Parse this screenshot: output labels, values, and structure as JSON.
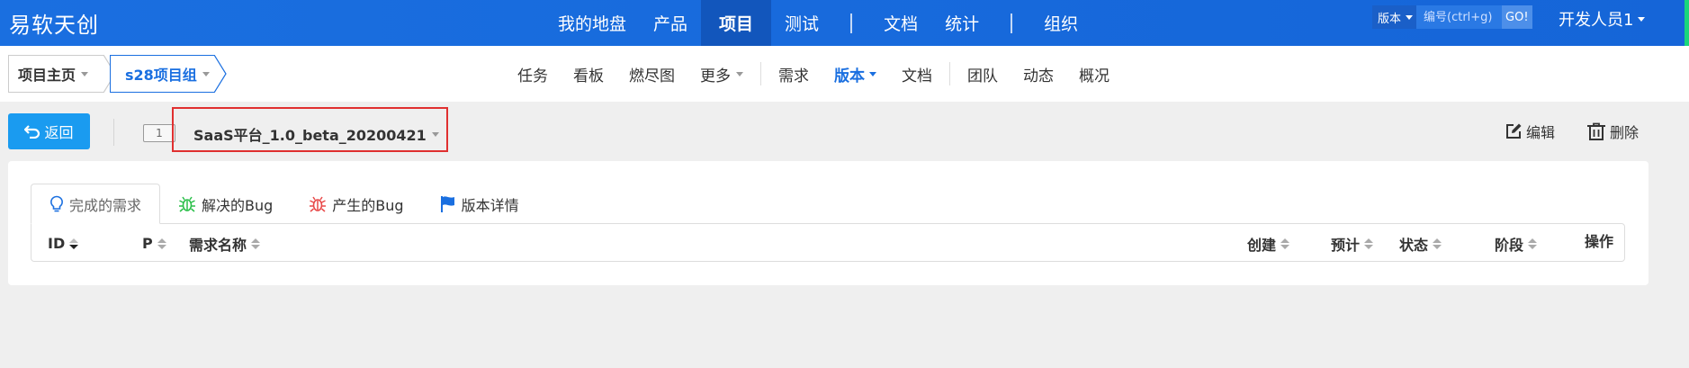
{
  "app": {
    "logo": "易软天创"
  },
  "top_nav": {
    "items": [
      "我的地盘",
      "产品",
      "项目",
      "测试",
      "文档",
      "统计",
      "组织"
    ],
    "active": "项目"
  },
  "search": {
    "type_label": "版本",
    "placeholder": "编号(ctrl+g)",
    "go_label": "GO!"
  },
  "user": {
    "name": "开发人员1"
  },
  "breadcrumb": {
    "home": "项目主页",
    "project": "s28项目组"
  },
  "sub_nav": {
    "items": [
      "任务",
      "看板",
      "燃尽图",
      "更多",
      "需求",
      "版本",
      "文档",
      "团队",
      "动态",
      "概况"
    ],
    "active": "版本"
  },
  "toolbar": {
    "back_label": "返回",
    "version_badge": "1",
    "version_name": "SaaS平台_1.0_beta_20200421",
    "edit_label": "编辑",
    "delete_label": "删除"
  },
  "tabs": [
    {
      "label": "完成的需求",
      "icon": "lightbulb-icon",
      "active": true
    },
    {
      "label": "解决的Bug",
      "icon": "bug-icon",
      "color": "#2bbf4a"
    },
    {
      "label": "产生的Bug",
      "icon": "bug-icon",
      "color": "#e84a4a"
    },
    {
      "label": "版本详情",
      "icon": "flag-icon",
      "color": "#1a6fe0"
    }
  ],
  "table": {
    "columns": [
      "ID",
      "P",
      "需求名称",
      "创建",
      "预计",
      "状态",
      "阶段",
      "操作"
    ]
  },
  "colors": {
    "topbar": "#1a6fe0",
    "accent": "#1a6fe0",
    "back_button": "#1a9bf0",
    "highlight": "#e03030"
  }
}
